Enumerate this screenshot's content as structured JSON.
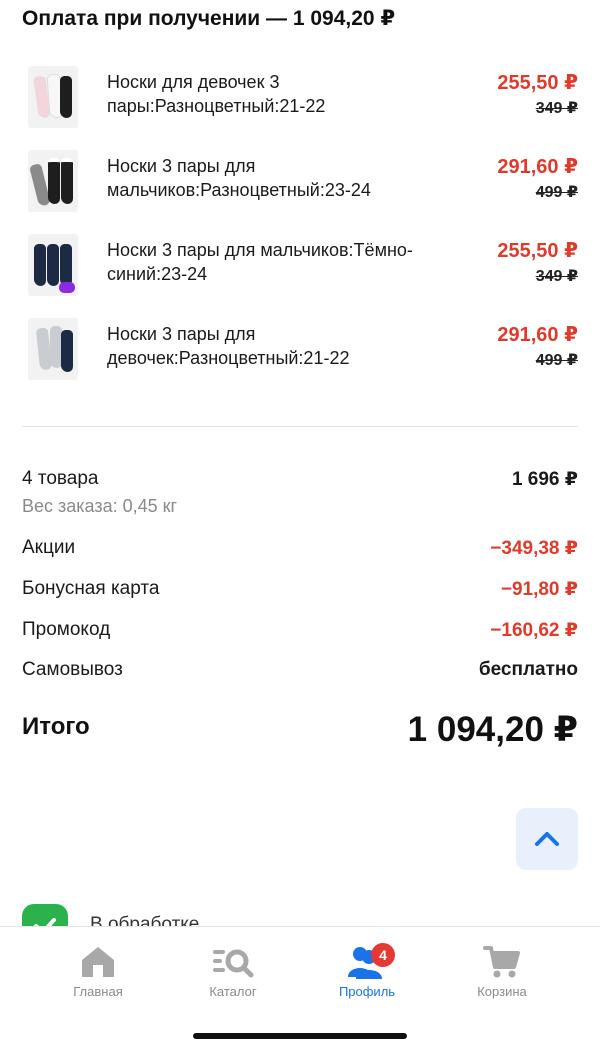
{
  "header": {
    "title": "Оплата при получении — 1 094,20 ₽"
  },
  "items": [
    {
      "name": "Носки для девочек 3 пары:Разноцветный:21-22",
      "price": "255,50 ₽",
      "old_price": "349 ₽",
      "thumb_icon": "pink-socks-thumbnail"
    },
    {
      "name": "Носки 3 пары для мальчиков:Разноцветный:23-24",
      "price": "291,60 ₽",
      "old_price": "499 ₽",
      "thumb_icon": "grey-striped-socks-thumbnail"
    },
    {
      "name": "Носки 3 пары для мальчиков:Тёмно-синий:23-24",
      "price": "255,50 ₽",
      "old_price": "349 ₽",
      "thumb_icon": "navy-socks-thumbnail"
    },
    {
      "name": "Носки 3 пары для девочек:Разноцветный:21-22",
      "price": "291,60 ₽",
      "old_price": "499 ₽",
      "thumb_icon": "grey-navy-socks-thumbnail"
    }
  ],
  "summary": {
    "count_label": "4 товара",
    "subtotal": "1 696 ₽",
    "weight": "Вес заказа: 0,45 кг",
    "promo_label": "Акции",
    "promo_value": "−349,38 ₽",
    "bonus_label": "Бонусная карта",
    "bonus_value": "−91,80 ₽",
    "code_label": "Промокод",
    "code_value": "−160,62 ₽",
    "pickup_label": "Самовывоз",
    "pickup_value": "бесплатно",
    "total_label": "Итого",
    "total_value": "1 094,20 ₽"
  },
  "status": {
    "text": "В обработке"
  },
  "tabbar": {
    "tabs": [
      {
        "label": "Главная",
        "icon": "home-icon"
      },
      {
        "label": "Каталог",
        "icon": "catalog-search-icon"
      },
      {
        "label": "Профиль",
        "icon": "profile-icon",
        "badge": "4",
        "active": true
      },
      {
        "label": "Корзина",
        "icon": "cart-icon"
      }
    ]
  },
  "colors": {
    "accent": "#1a73e8",
    "price_red": "#e03a2b",
    "success_green": "#2bb24c",
    "badge_red": "#e53935"
  }
}
